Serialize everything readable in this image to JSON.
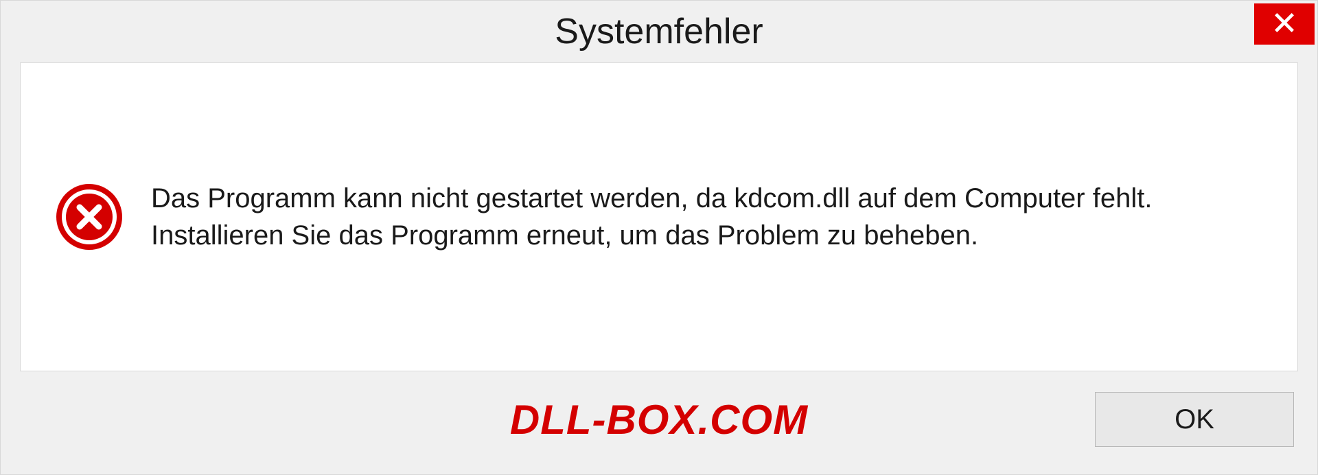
{
  "dialog": {
    "title": "Systemfehler",
    "message": "Das Programm kann nicht gestartet werden, da kdcom.dll auf dem Computer fehlt. Installieren Sie das Programm erneut, um das Problem zu beheben.",
    "ok_label": "OK"
  },
  "watermark": "DLL-BOX.COM"
}
